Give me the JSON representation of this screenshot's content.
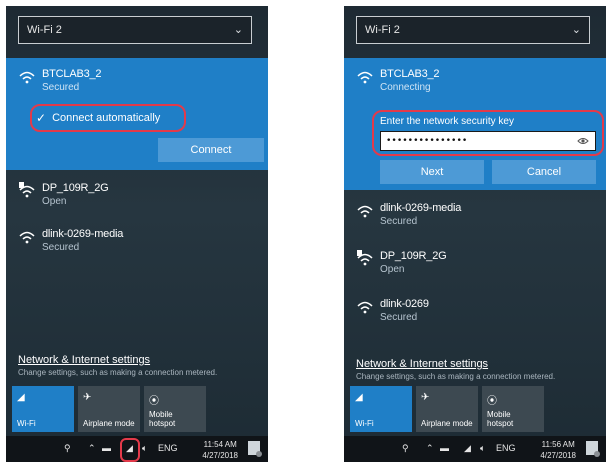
{
  "left": {
    "dropdown": "Wi-Fi 2",
    "selected_network": {
      "name": "BTCLAB3_2",
      "status": "Secured"
    },
    "connect_automatically": "Connect automatically",
    "connect_button": "Connect",
    "networks": [
      {
        "name": "DP_109R_2G",
        "status": "Open"
      },
      {
        "name": "dlink-0269-media",
        "status": "Secured"
      }
    ],
    "settings_link": "Network & Internet settings",
    "settings_desc": "Change settings, such as making a connection metered.",
    "tiles": [
      {
        "label": "Wi-Fi",
        "icon": "wifi-icon"
      },
      {
        "label": "Airplane mode",
        "icon": "airplane-icon"
      },
      {
        "label": "Mobile hotspot",
        "icon": "hotspot-icon"
      }
    ],
    "taskbar": {
      "lang": "ENG",
      "time": "11:54 AM",
      "date": "4/27/2018"
    }
  },
  "right": {
    "dropdown": "Wi-Fi 2",
    "selected_network": {
      "name": "BTCLAB3_2",
      "status": "Connecting"
    },
    "key_label": "Enter the network security key",
    "key_value": "•••••••••••••••",
    "next_button": "Next",
    "cancel_button": "Cancel",
    "networks": [
      {
        "name": "dlink-0269-media",
        "status": "Secured"
      },
      {
        "name": "DP_109R_2G",
        "status": "Open"
      },
      {
        "name": "dlink-0269",
        "status": "Secured"
      }
    ],
    "settings_link": "Network & Internet settings",
    "settings_desc": "Change settings, such as making a connection metered.",
    "tiles": [
      {
        "label": "Wi-Fi",
        "icon": "wifi-icon"
      },
      {
        "label": "Airplane mode",
        "icon": "airplane-icon"
      },
      {
        "label": "Mobile hotspot",
        "icon": "hotspot-icon"
      }
    ],
    "taskbar": {
      "lang": "ENG",
      "time": "11:56 AM",
      "date": "4/27/2018"
    }
  },
  "colors": {
    "accent": "#1f7fc7",
    "highlight": "#e33a4a",
    "button": "#4d9ad6"
  }
}
